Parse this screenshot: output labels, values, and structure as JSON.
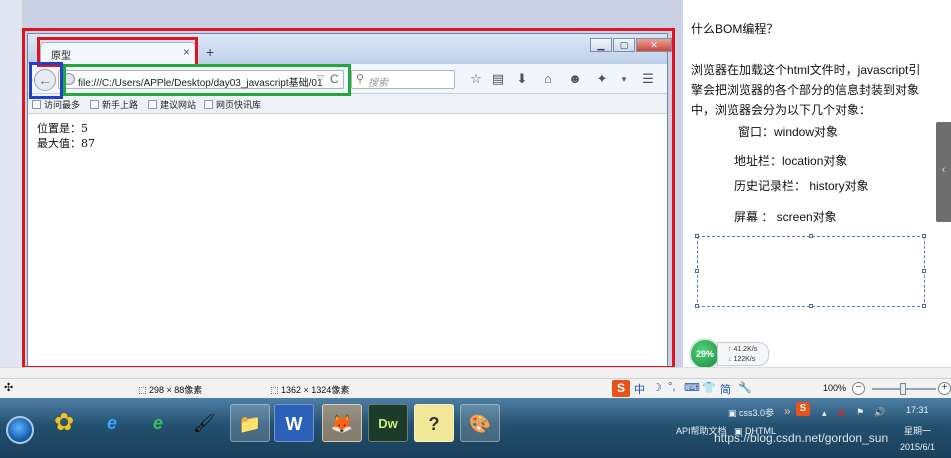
{
  "browser": {
    "tab_title": "原型",
    "tab_close": "×",
    "new_tab": "+",
    "window_buttons": [
      "▁",
      "▢",
      "✕"
    ],
    "back": "←",
    "url": "file:///C:/Users/APPle/Desktop/day03_javascript基础/01",
    "url_dropdown": "▽",
    "reload": "C",
    "search_placeholder": "搜索",
    "toolbar_icons": [
      "star-icon",
      "reader-icon",
      "download-icon",
      "home-icon",
      "chat-icon",
      "extension-icon",
      "menu-icon"
    ],
    "bookmarks": [
      "访问最多",
      "新手上路",
      "建议网站",
      "网页快讯库"
    ],
    "content_lines": [
      "位置是：5",
      "最大值：87"
    ]
  },
  "notes": {
    "title": "什么BOM编程？",
    "paragraph": [
      "浏览器在加载这个html文件时，javascript引",
      "擎会把浏览器的各个部分的信息封装到对象",
      "中，浏览器会分为以下几个对象："
    ],
    "objects": [
      "窗口：window对象",
      "地址栏：location对象",
      "历史记录栏： history对象",
      "屏幕 ： screen对象"
    ]
  },
  "speed_widget": {
    "percent": "29%",
    "up": "41.2K/s",
    "down": "122K/s"
  },
  "statusbar": {
    "selection_size": "298 × 88像素",
    "image_size": "1362 × 1324像素",
    "zoom": "100%",
    "zoom_minus": "−",
    "zoom_plus": "+",
    "ime_logo": "S",
    "ime_items": [
      "中",
      "☽",
      "°,",
      "⌨",
      "👕",
      "简",
      "🔧"
    ]
  },
  "taskbar": {
    "apps": [
      {
        "name": "ie-icon",
        "glyph": "e"
      },
      {
        "name": "browser-icon",
        "glyph": "e"
      },
      {
        "name": "paint-icon",
        "glyph": "🖌"
      },
      {
        "name": "explorer-icon",
        "glyph": "📁"
      },
      {
        "name": "word-icon",
        "glyph": "W"
      },
      {
        "name": "firefox-icon",
        "glyph": "🦊"
      },
      {
        "name": "dreamweaver-icon",
        "glyph": "Dw"
      },
      {
        "name": "help-icon",
        "glyph": "?"
      },
      {
        "name": "drawing-icon",
        "glyph": "🎨"
      }
    ],
    "tray_items": [
      "css3.0参",
      "API帮助文档",
      "DHTML"
    ],
    "time": "17:31",
    "weekday": "星期一",
    "date": "2015/6/1",
    "watermark": "https://blog.csdn.net/gordon_sun"
  },
  "colors": {
    "annotation_red": "#e0141e",
    "annotation_blue": "#1f3fd1",
    "annotation_green": "#22a83a"
  }
}
